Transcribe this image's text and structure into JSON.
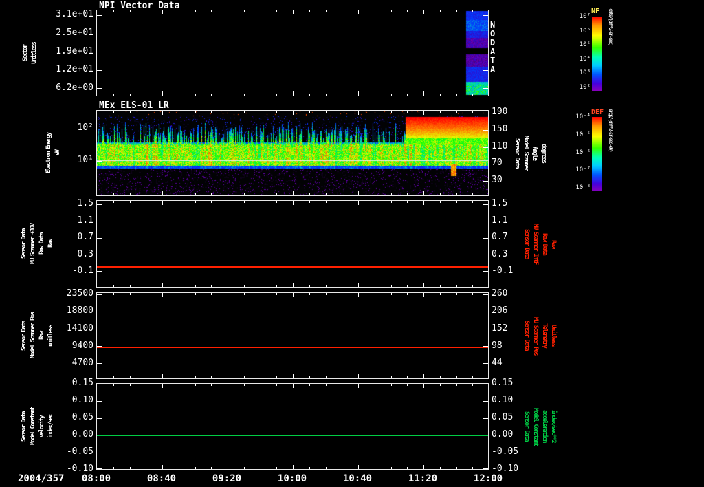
{
  "titles": {
    "panel1": "NPI Vector Data",
    "panel2": "MEx ELS-01 LR"
  },
  "colors": {
    "axis": "#ffffff",
    "red": "#ff2000",
    "green": "#00cc44",
    "white_line": "#cfcfcf",
    "nf_title": "#ffee55",
    "def_title": "#ff4422"
  },
  "xaxis": {
    "date": "2004/357",
    "ticks": [
      "08:00",
      "08:40",
      "09:20",
      "10:00",
      "10:40",
      "11:20",
      "12:00"
    ]
  },
  "panel1": {
    "left_label": [
      "Sector",
      "Unitless"
    ],
    "left_ticks": [
      "3.1e+01",
      "2.5e+01",
      "1.9e+01",
      "1.2e+01",
      "6.2e+00"
    ],
    "no_data": "NO DATA"
  },
  "panel2": {
    "left_label": [
      "Electron Energy",
      "eV"
    ],
    "left_ticks": [
      "10²",
      "10¹"
    ],
    "right_ticks": [
      "190",
      "150",
      "110",
      "70",
      "30"
    ],
    "right_label": [
      "Sensor Data",
      "Model Scanner",
      "Angle",
      "degrees"
    ]
  },
  "panel3": {
    "left_label": [
      "Sensor Data",
      "MU Scanner +30V",
      "Raw Data",
      "Raw"
    ],
    "left_ticks": [
      "1.5",
      "1.1",
      "0.7",
      "0.3",
      "-0.1"
    ],
    "right_ticks": [
      "1.5",
      "1.1",
      "0.7",
      "0.3",
      "-0.1"
    ],
    "right_label": [
      "Sensor Data",
      "MU Scanner IntF",
      "Raw Data",
      "Raw"
    ]
  },
  "panel4": {
    "left_label": [
      "Sensor Data",
      "Model Scanner Pos",
      "Raw",
      "unitless"
    ],
    "left_ticks": [
      "23500",
      "18800",
      "14100",
      "9400",
      "4700"
    ],
    "right_ticks": [
      "260",
      "206",
      "152",
      "98",
      "44"
    ],
    "right_label": [
      "Sensor Data",
      "MU Scanner Pos",
      "Telemetry",
      "Unitless"
    ]
  },
  "panel5": {
    "left_label": [
      "Sensor Data",
      "Model Constant",
      "velocity",
      "index/sec"
    ],
    "left_ticks": [
      "0.15",
      "0.10",
      "0.05",
      "0.00",
      "-0.05",
      "-0.10"
    ],
    "right_ticks": [
      "0.15",
      "0.10",
      "0.05",
      "0.00",
      "-0.05",
      "-0.10"
    ],
    "right_label": [
      "Sensor Data",
      "Model Constant",
      "acceleration",
      "index/sec**2"
    ]
  },
  "colorbars": {
    "nf": {
      "name": "NF",
      "ticks": [
        "10⁷",
        "10⁶",
        "10⁵",
        "10⁴",
        "10³",
        "10²"
      ],
      "unit": "cnts/(cm**2-sr-sec)"
    },
    "def": {
      "name": "DEF",
      "ticks": [
        "10⁻⁴",
        "10⁻⁵",
        "10⁻⁶",
        "10⁻⁷",
        "10⁻⁸"
      ],
      "unit": "ergs/(cm**2-sr-sec-eV)"
    }
  },
  "chart_data": [
    {
      "type": "heatmap",
      "title": "NPI Vector Data",
      "ylabel": "Sector (Unitless)",
      "ytick_values": [
        31,
        25,
        19,
        12,
        6.2
      ],
      "colorbar": {
        "name": "NF",
        "unit": "cnts/(cm**2-sr-sec)",
        "tick_exponents": [
          7,
          6,
          5,
          4,
          3,
          2
        ]
      },
      "status": "NO DATA from 08:00 until ~11:45, colored sector strip from ~11:45 to 12:00",
      "data_strip": {
        "start_frac": 0.945,
        "end_frac": 1.0,
        "gap_row_frac": [
          0.45,
          0.52
        ],
        "palette": "purple-blue-cyan"
      }
    },
    {
      "type": "spectrogram",
      "title": "MEx ELS-01 LR",
      "xlabel": "time (2004/357 08:00 - 12:00)",
      "ylabel": "Electron Energy (eV)",
      "yscale": "log",
      "ytick_values": [
        100,
        10
      ],
      "right_axis": {
        "label": "Sensor Data Model Scanner Angle (degrees)",
        "tick_values": [
          190,
          150,
          110,
          70,
          30
        ]
      },
      "colorbar": {
        "name": "DEF",
        "unit": "ergs/(cm**2-sr-sec-eV)",
        "tick_exponents": [
          -4,
          -5,
          -6,
          -7,
          -8
        ]
      },
      "features": {
        "main_band_eV": [
          7,
          30
        ],
        "plume_max_eV": 150,
        "plume_density": 0.18,
        "white_line_eV": 10,
        "speckle_density": 0.07,
        "red_band": {
          "start_frac": 0.79,
          "eV": [
            50,
            220
          ]
        },
        "top_speck_min_eV": 230
      }
    },
    {
      "type": "line",
      "ylim": [
        -0.1,
        1.5
      ],
      "series": [
        {
          "name": "Sensor Data MU Scanner +30V Raw Data (Raw)",
          "color_key": "red",
          "constant_value": 0.0
        }
      ]
    },
    {
      "type": "line",
      "ylim": [
        4700,
        23500
      ],
      "right_ylim": [
        44,
        260
      ],
      "series": [
        {
          "name": "Sensor Data Model Scanner Pos Raw (unitless)",
          "color_key": "white_line",
          "axis": "left",
          "constant_value": 11500
        },
        {
          "name": "Sensor Data MU Scanner Pos Telemetry (Unitless)",
          "color_key": "red",
          "axis": "right",
          "constant_value": 93
        }
      ]
    },
    {
      "type": "line",
      "ylim": [
        -0.1,
        0.15
      ],
      "series": [
        {
          "name": "Sensor Data Model Constant velocity (index/sec)",
          "color_key": "green",
          "constant_value": 0.0
        }
      ]
    },
    {
      "type": "axis",
      "x_date": "2004/357",
      "x_categories": [
        "08:00",
        "08:40",
        "09:20",
        "10:00",
        "10:40",
        "11:20",
        "12:00"
      ]
    }
  ]
}
